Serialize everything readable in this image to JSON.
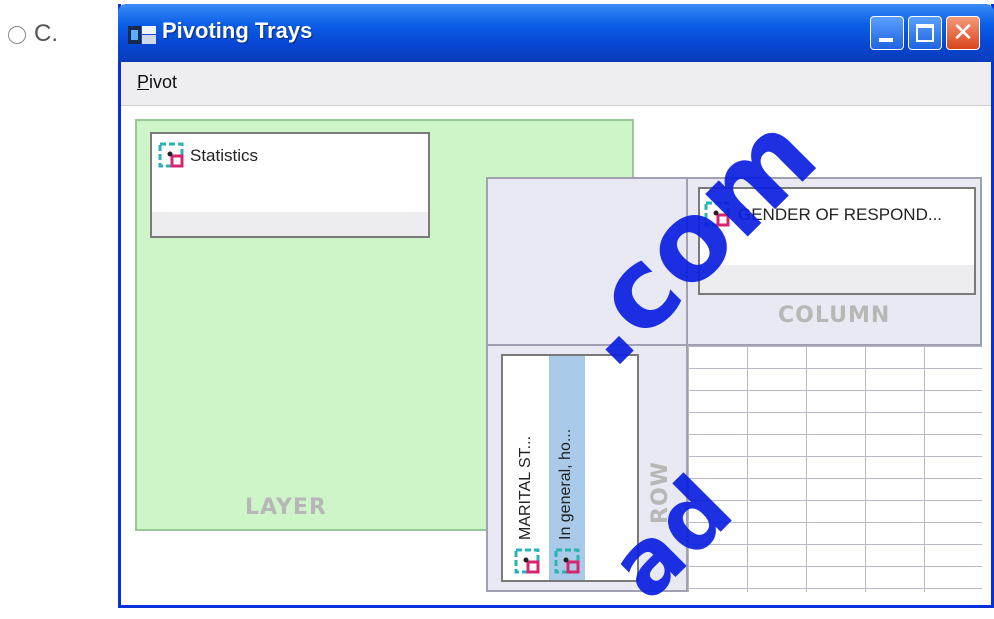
{
  "option": {
    "letter": "C."
  },
  "window": {
    "title": "Pivoting Trays",
    "close_glyph": "✕"
  },
  "menu": {
    "pivot_first": "P",
    "pivot_rest": "ivot"
  },
  "trays": {
    "layer": {
      "label": "LAYER",
      "items": [
        "Statistics"
      ]
    },
    "column": {
      "label": "COLUMN",
      "items": [
        "GENDER OF RESPOND..."
      ]
    },
    "row": {
      "label": "ROW",
      "items": [
        "MARITAL ST...",
        "In general, ho..."
      ]
    }
  },
  "watermark": {
    "text_a": ".com",
    "text_b": "ad"
  },
  "colors": {
    "layer_bg": "#cdf5c8",
    "title_blue": "#0b5fe6",
    "selected_row_item": "#a9cbe9",
    "watermark": "#0a1fe0"
  },
  "icons": {
    "window": "pivot-app-icon",
    "dimension": "dimension-icon"
  }
}
